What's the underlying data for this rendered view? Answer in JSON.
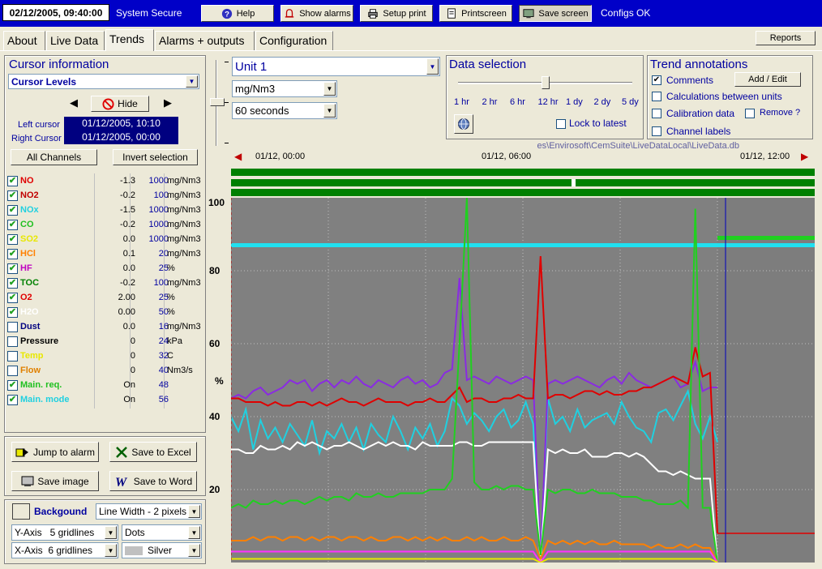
{
  "topbar": {
    "clock": "02/12/2005, 09:40:00",
    "status_left": "System Secure",
    "status_right": "Configs OK",
    "buttons": {
      "help": "Help",
      "show_alarms": "Show alarms",
      "setup_print": "Setup print",
      "printscreen": "Printscreen",
      "save_screen": "Save screen"
    }
  },
  "tabs": [
    "About",
    "Live Data",
    "Trends",
    "Alarms + outputs",
    "Configuration"
  ],
  "active_tab": "Trends",
  "reports_label": "Reports",
  "cursor_info": {
    "title": "Cursor information",
    "mode": "Cursor Levels",
    "hide_label": "Hide",
    "left_cursor_label": "Left cursor",
    "right_cursor_label": "Right Cursor",
    "left_cursor_time": "01/12/2005, 10:10",
    "right_cursor_time": "01/12/2005, 00:00",
    "all_channels_label": "All Channels",
    "invert_label": "Invert selection"
  },
  "channels": [
    {
      "name": "NO",
      "checked": true,
      "value": "-1.3",
      "range": "1000",
      "unit": "mg/Nm3",
      "color": "#e00000"
    },
    {
      "name": "NO2",
      "checked": true,
      "value": "-0.2",
      "range": "100",
      "unit": "mg/Nm3",
      "color": "#c00000"
    },
    {
      "name": "NOx",
      "checked": true,
      "value": "-1.5",
      "range": "1000",
      "unit": "mg/Nm3",
      "color": "#20d0e0"
    },
    {
      "name": "CO",
      "checked": true,
      "value": "-0.2",
      "range": "1000",
      "unit": "mg/Nm3",
      "color": "#20c020"
    },
    {
      "name": "SO2",
      "checked": true,
      "value": "0.0",
      "range": "1000",
      "unit": "mg/Nm3",
      "color": "#e8e800"
    },
    {
      "name": "HCl",
      "checked": true,
      "value": "0.1",
      "range": "20",
      "unit": "mg/Nm3",
      "color": "#ff8000"
    },
    {
      "name": "HF",
      "checked": true,
      "value": "0.0",
      "range": "25",
      "unit": "%",
      "color": "#c000c0"
    },
    {
      "name": "TOC",
      "checked": true,
      "value": "-0.2",
      "range": "100",
      "unit": "mg/Nm3",
      "color": "#008000"
    },
    {
      "name": "O2",
      "checked": true,
      "value": "2.00",
      "range": "25",
      "unit": "%",
      "color": "#e00000"
    },
    {
      "name": "H2O",
      "checked": true,
      "value": "0.00",
      "range": "50",
      "unit": "%",
      "color": "#ffffff"
    },
    {
      "name": "Dust",
      "checked": false,
      "value": "0.0",
      "range": "16",
      "unit": "mg/Nm3",
      "color": "#000080"
    },
    {
      "name": "Pressure",
      "checked": false,
      "value": "0",
      "range": "24",
      "unit": "kPa",
      "color": "#000000"
    },
    {
      "name": "Temp",
      "checked": false,
      "value": "0",
      "range": "32",
      "unit": "C",
      "color": "#e8e800"
    },
    {
      "name": "Flow",
      "checked": false,
      "value": "0",
      "range": "40",
      "unit": "Nm3/s",
      "color": "#e08000"
    },
    {
      "name": "Main. req.",
      "checked": true,
      "value": "On",
      "range": "48",
      "unit": "",
      "color": "#20c020"
    },
    {
      "name": "Main. mode",
      "checked": true,
      "value": "On",
      "range": "56",
      "unit": "",
      "color": "#20d0e0"
    }
  ],
  "actions": {
    "jump_to_alarm": "Jump to alarm",
    "save_to_excel": "Save to Excel",
    "save_image": "Save image",
    "save_to_word": "Save to Word"
  },
  "appearance": {
    "background_label": "Backgound",
    "line_width": "Line Width - 2 pixels",
    "y_axis": "Y-Axis   5 gridlines",
    "x_axis": "X-Axis  6 gridlines",
    "grid_style": "Dots",
    "grid_color": "Silver",
    "background_color": "#808080"
  },
  "unit_select": "Unit 1",
  "units_select": "mg/Nm3",
  "interval_select": "60 seconds",
  "data_selection": {
    "title": "Data selection",
    "ticks": [
      "1 hr",
      "2 hr",
      "6 hr",
      "12 hr",
      "1 dy",
      "2 dy",
      "5 dy"
    ],
    "selected": "12 hr",
    "lock_label": "Lock to latest"
  },
  "trend_annotations": {
    "title": "Trend annotations",
    "add_edit": "Add / Edit",
    "comments": "Comments",
    "calculations": "Calculations between units",
    "calibration": "Calibration data",
    "remove": "Remove ?",
    "channel_labels": "Channel labels"
  },
  "db_path": "es\\Envirosoft\\CemSuite\\LiveDataLocal\\LiveData.db",
  "time_axis": {
    "start": "01/12, 00:00",
    "mid": "01/12, 06:00",
    "end": "01/12, 12:00"
  },
  "chart_data": {
    "type": "line",
    "ylabel": "%",
    "ylim": [
      0,
      100
    ],
    "yticks": [
      20,
      40,
      60,
      80,
      100
    ],
    "grid": "dots",
    "x_range": [
      "01/12, 00:00",
      "01/12, 12:00"
    ],
    "series": [
      {
        "key": "NOx",
        "color": "#20d0e0",
        "values": [
          40,
          36,
          42,
          31,
          39,
          34,
          37,
          33,
          38,
          35,
          32,
          39,
          30,
          36,
          34,
          38,
          33,
          37,
          31,
          38,
          35,
          33,
          40,
          36,
          31,
          37,
          34,
          38,
          32,
          36,
          45,
          43,
          38,
          41,
          39,
          36,
          40,
          42,
          37,
          39,
          44,
          38,
          2,
          45,
          38,
          40,
          36,
          42,
          37,
          39,
          40,
          41,
          38,
          44,
          40,
          37,
          36,
          33,
          41,
          42,
          39,
          43,
          47,
          38,
          34,
          40,
          33
        ]
      },
      {
        "key": "NO2",
        "color": "#8a2be2",
        "values": [
          45,
          46,
          45,
          47,
          48,
          46,
          47,
          48,
          50,
          49,
          50,
          47,
          49,
          50,
          48,
          50,
          49,
          51,
          49,
          48,
          50,
          49,
          48,
          50,
          51,
          49,
          50,
          48,
          49,
          52,
          53,
          78,
          50,
          51,
          50,
          49,
          51,
          50,
          49,
          50,
          51,
          50,
          1,
          49,
          50,
          49,
          50,
          51,
          50,
          49,
          48,
          50,
          51,
          49,
          52,
          50,
          49,
          48,
          49,
          50,
          51,
          48,
          49,
          55,
          47,
          48,
          48
        ]
      },
      {
        "key": "NO",
        "color": "#e00000",
        "values": [
          45,
          45,
          44,
          44,
          44,
          43,
          44,
          43,
          43,
          44,
          44,
          43,
          44,
          43,
          44,
          45,
          44,
          44,
          43,
          44,
          45,
          44,
          44,
          44,
          43,
          44,
          44,
          45,
          44,
          44,
          46,
          48,
          44,
          45,
          45,
          44,
          44,
          45,
          45,
          46,
          45,
          45,
          84,
          45,
          46,
          46,
          45,
          46,
          47,
          47,
          46,
          47,
          46,
          46,
          47,
          47,
          48,
          48,
          49,
          50,
          51,
          50,
          49,
          59,
          51,
          52,
          8
        ]
      },
      {
        "key": "H2O",
        "color": "#ffffff",
        "values": [
          31,
          31,
          30,
          30,
          32,
          31,
          31,
          32,
          31,
          33,
          32,
          33,
          32,
          31,
          32,
          32,
          33,
          32,
          31,
          32,
          33,
          32,
          33,
          32,
          32,
          31,
          33,
          32,
          32,
          32,
          32,
          33,
          33,
          32,
          32,
          33,
          33,
          33,
          33,
          33,
          33,
          33,
          0,
          31,
          30,
          31,
          30,
          30,
          31,
          29,
          29,
          29,
          30,
          30,
          29,
          30,
          29,
          27,
          25,
          25,
          24,
          25,
          24,
          23,
          23,
          23,
          0
        ]
      },
      {
        "key": "CO",
        "color": "#20d020",
        "values": [
          15,
          16,
          15,
          17,
          16,
          16,
          17,
          16,
          17,
          17,
          16,
          17,
          18,
          17,
          18,
          18,
          17,
          19,
          18,
          18,
          19,
          18,
          18,
          19,
          19,
          19,
          19,
          20,
          20,
          20,
          23,
          60,
          100,
          22,
          20,
          20,
          21,
          20,
          21,
          21,
          20,
          20,
          2,
          20,
          19,
          20,
          20,
          19,
          19,
          20,
          19,
          19,
          19,
          18,
          18,
          18,
          17,
          17,
          16,
          16,
          16,
          17,
          15,
          97,
          15,
          15,
          0
        ]
      },
      {
        "key": "HCl",
        "color": "#ff8000",
        "values": [
          6,
          6,
          6,
          7,
          6,
          7,
          7,
          6,
          7,
          7,
          6,
          7,
          6,
          7,
          7,
          6,
          7,
          7,
          6,
          7,
          6,
          6,
          7,
          7,
          6,
          7,
          6,
          7,
          6,
          7,
          6,
          6,
          7,
          6,
          7,
          6,
          6,
          7,
          6,
          6,
          7,
          6,
          1,
          6,
          5,
          6,
          5,
          6,
          5,
          6,
          5,
          5,
          6,
          5,
          5,
          5,
          5,
          4,
          5,
          4,
          4,
          5,
          4,
          5,
          4,
          4,
          0
        ]
      },
      {
        "key": "HF",
        "color": "#ff30ff",
        "values": [
          3,
          3,
          3,
          3,
          3,
          3,
          3,
          3,
          3,
          3,
          3,
          3,
          3,
          3,
          3,
          3,
          3,
          3,
          3,
          3,
          3,
          3,
          3,
          3,
          3,
          3,
          3,
          3,
          3,
          3,
          3,
          3,
          3,
          3,
          3,
          3,
          3,
          3,
          3,
          3,
          3,
          3,
          0,
          3,
          3,
          3,
          3,
          3,
          3,
          3,
          3,
          3,
          3,
          3,
          3,
          3,
          3,
          3,
          3,
          3,
          3,
          3,
          3,
          3,
          3,
          3,
          0
        ]
      },
      {
        "key": "SO2",
        "color": "#e8e800",
        "values": [
          1,
          1,
          1,
          1,
          1,
          1,
          1,
          1,
          1,
          1,
          1,
          1,
          1,
          1,
          1,
          1,
          1,
          1,
          1,
          1,
          1,
          1,
          1,
          1,
          1,
          1,
          1,
          1,
          1,
          1,
          1,
          1,
          1,
          1,
          1,
          1,
          1,
          1,
          1,
          1,
          1,
          1,
          0,
          1,
          1,
          1,
          1,
          1,
          1,
          1,
          1,
          1,
          1,
          1,
          1,
          1,
          1,
          1,
          1,
          1,
          1,
          1,
          1,
          1,
          1,
          1,
          0
        ]
      }
    ],
    "main_mode_level": 87,
    "o2_after_level": 8
  }
}
